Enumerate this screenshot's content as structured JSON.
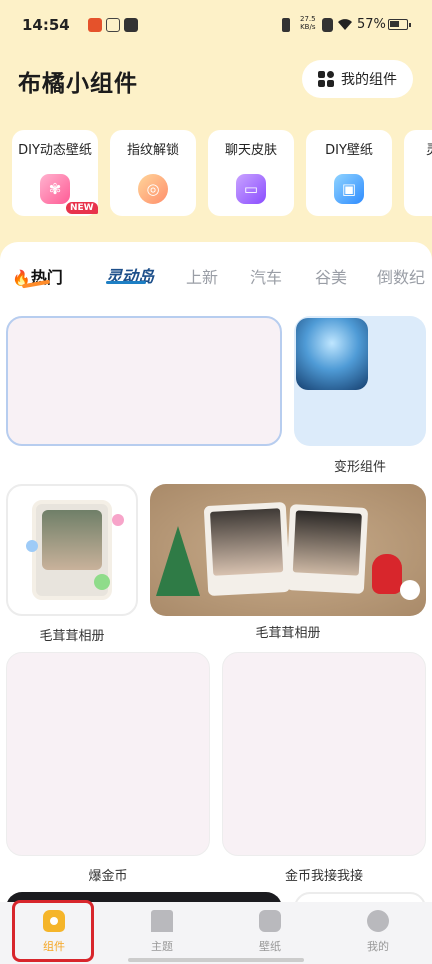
{
  "status_bar": {
    "time": "14:54",
    "net_speed_top": "27.5",
    "net_speed_unit": "KB/s",
    "battery_text": "57%",
    "battery_level": 0.57
  },
  "header": {
    "title": "布橘小组件",
    "my_widgets_label": "我的组件"
  },
  "features": [
    {
      "label": "DIY动态壁纸",
      "icon": "pinwheel-icon",
      "badge": "NEW"
    },
    {
      "label": "指纹解锁",
      "icon": "fingerprint-icon"
    },
    {
      "label": "聊天皮肤",
      "icon": "chat-bubble-icon"
    },
    {
      "label": "DIY壁纸",
      "icon": "photo-icon"
    },
    {
      "label": "灵",
      "icon": "partial-card"
    }
  ],
  "tabs": {
    "hot": "热门",
    "brand": "灵动岛",
    "items": [
      "上新",
      "汽车",
      "谷美",
      "倒数纪"
    ]
  },
  "widgets": {
    "transform_label": "变形组件",
    "fluffy_album_small_label": "毛茸茸相册",
    "fluffy_album_large_label": "毛茸茸相册",
    "coin_burst_label": "爆金币",
    "coin_catch_label": "金币我接我接"
  },
  "bottom_nav": [
    {
      "label": "组件",
      "icon": "home-icon",
      "active": true
    },
    {
      "label": "主题",
      "icon": "theme-icon",
      "active": false
    },
    {
      "label": "壁纸",
      "icon": "image-icon",
      "active": false
    },
    {
      "label": "我的",
      "icon": "smile-icon",
      "active": false
    }
  ],
  "colors": {
    "background": "#fdf1c8",
    "accent": "#f5b52a",
    "highlight_box": "#d8262c"
  }
}
